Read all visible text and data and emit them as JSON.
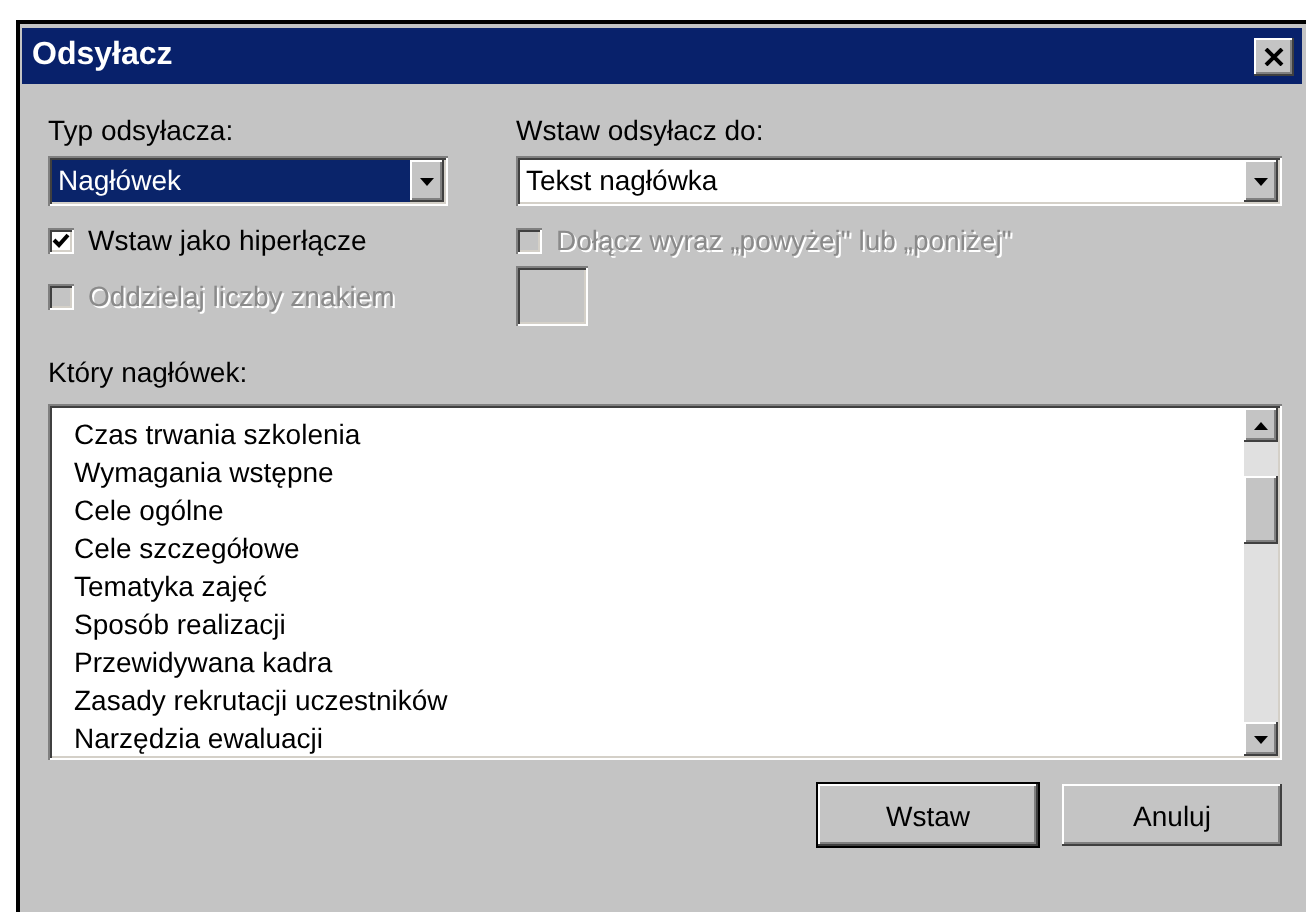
{
  "window": {
    "title": "Odsyłacz"
  },
  "reference_type": {
    "label": "Typ odsyłacza:",
    "value": "Nagłówek",
    "highlighted": true
  },
  "insert_reference_to": {
    "label": "Wstaw odsyłacz do:",
    "value": "Tekst nagłówka",
    "highlighted": false
  },
  "options": [
    {
      "label": "Wstaw jako hiperłącze",
      "checked": true,
      "disabled": false
    },
    {
      "label": "Oddzielaj liczby znakiem",
      "checked": false,
      "disabled": true
    }
  ],
  "include_above_below": {
    "label": "Dołącz wyraz „powyżej\" lub „poniżej\"",
    "checked": false,
    "disabled": true
  },
  "separator_field": {
    "disabled": true
  },
  "heading_list": {
    "label": "Który nagłówek:",
    "items": [
      {
        "text": "Czas trwania szkolenia",
        "selected": false
      },
      {
        "text": "Wymagania wstępne",
        "selected": false
      },
      {
        "text": "Cele ogólne",
        "selected": false
      },
      {
        "text": "Cele szczegółowe",
        "selected": false
      },
      {
        "text": "Tematyka zajęć",
        "selected": false
      },
      {
        "text": "Sposób realizacji",
        "selected": false
      },
      {
        "text": "Przewidywana kadra",
        "selected": false
      },
      {
        "text": "Zasady rekrutacji uczestników",
        "selected": false
      },
      {
        "text": "Narzędzia ewaluacji",
        "selected": false
      }
    ]
  },
  "buttons": [
    {
      "label": "Wstaw",
      "default": true
    },
    {
      "label": "Anuluj",
      "default": false
    }
  ]
}
